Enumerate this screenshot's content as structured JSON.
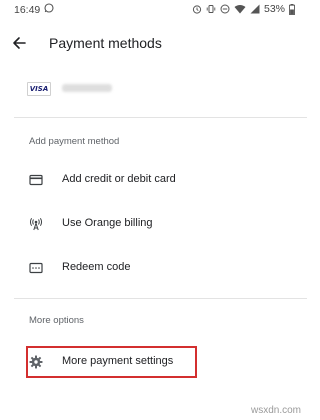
{
  "status_bar": {
    "time": "16:49",
    "battery_percent": "53%"
  },
  "app_bar": {
    "title": "Payment methods",
    "back_icon": "arrow-back-icon"
  },
  "saved_card": {
    "brand": "VISA"
  },
  "sections": {
    "add_payment_method": "Add payment method",
    "more_options": "More options"
  },
  "menu": {
    "add_card": {
      "label": "Add credit or debit card",
      "icon": "credit-card-icon"
    },
    "orange_billing": {
      "label": "Use Orange billing",
      "icon": "antenna-icon"
    },
    "redeem_code": {
      "label": "Redeem code",
      "icon": "gift-card-icon"
    },
    "more_settings": {
      "label": "More payment settings",
      "icon": "gear-icon"
    }
  },
  "watermark": "wsxdn.com",
  "colors": {
    "highlight": "#d32f2f",
    "text_primary": "#202124",
    "text_secondary": "#5f6368"
  }
}
